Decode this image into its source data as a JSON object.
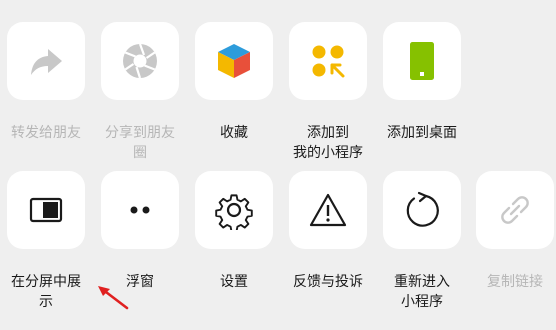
{
  "sheet": {
    "row1": [
      {
        "label": "转发给朋友",
        "icon": "forward-arrow-icon",
        "disabled": true
      },
      {
        "label": "分享到朋友\n圈",
        "icon": "moments-shutter-icon",
        "disabled": true
      },
      {
        "label": "收藏",
        "icon": "favorite-cube-icon",
        "disabled": false
      },
      {
        "label": "添加到\n我的小程序",
        "icon": "add-mini-program-icon",
        "disabled": false
      },
      {
        "label": "添加到桌面",
        "icon": "add-to-desktop-icon",
        "disabled": false
      }
    ],
    "row2": [
      {
        "label": "在分屏中展\n示",
        "icon": "split-screen-icon",
        "disabled": false
      },
      {
        "label": "浮窗",
        "icon": "floating-window-icon",
        "disabled": false
      },
      {
        "label": "设置",
        "icon": "settings-gear-icon",
        "disabled": false
      },
      {
        "label": "反馈与投诉",
        "icon": "warning-triangle-icon",
        "disabled": false
      },
      {
        "label": "重新进入\n小程序",
        "icon": "reload-icon",
        "disabled": false
      },
      {
        "label": "复制链接",
        "icon": "link-icon",
        "disabled": true
      }
    ]
  },
  "colors": {
    "background": "#efefef",
    "tile": "#ffffff",
    "text": "#1a1a1a",
    "disabled": "#b6b6b6",
    "accent_yellow": "#f4b800",
    "accent_green": "#86c100",
    "annotation_red": "#e02020"
  }
}
